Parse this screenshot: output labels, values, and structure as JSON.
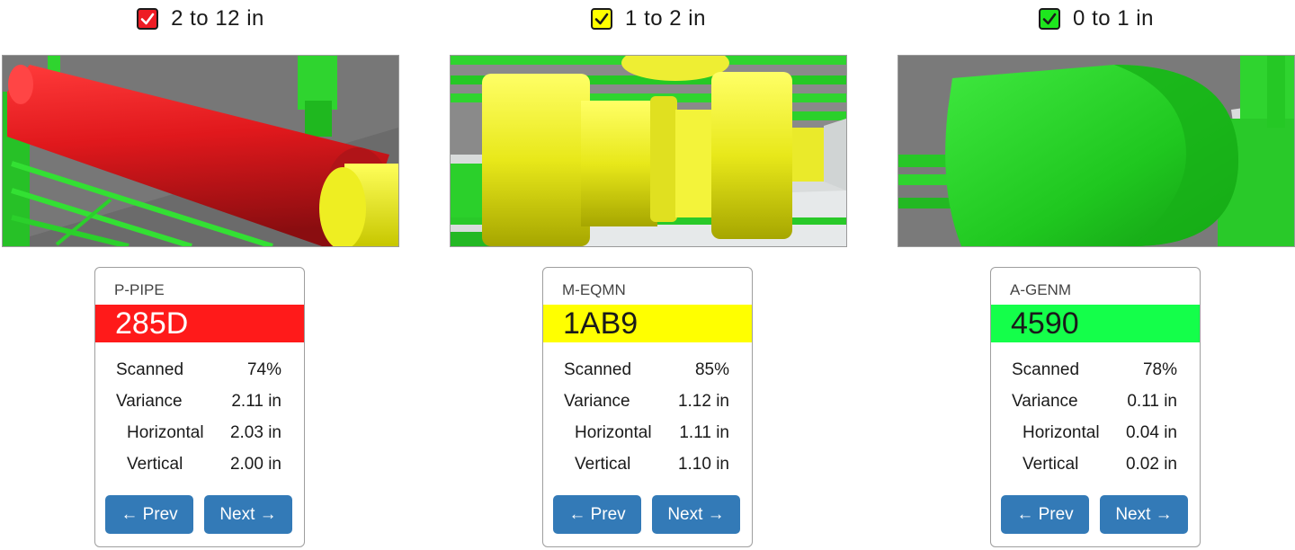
{
  "panels": [
    {
      "legend": {
        "label": "2 to 12 in",
        "color": "#ee1c24",
        "checked": true
      },
      "layer": "P-PIPE",
      "id": "285D",
      "id_color": "#ff1a1a",
      "id_text_color": "#ffffff",
      "stats": {
        "scanned_label": "Scanned",
        "scanned": "74%",
        "variance_label": "Variance",
        "variance": "2.11 in",
        "horizontal_label": "Horizontal",
        "horizontal": "2.03 in",
        "vertical_label": "Vertical",
        "vertical": "2.00 in"
      },
      "prev_label": "← Prev",
      "next_label": "Next →"
    },
    {
      "legend": {
        "label": "1 to 2 in",
        "color": "#ffff00",
        "checked": true
      },
      "layer": "M-EQMN",
      "id": "1AB9",
      "id_color": "#ffff00",
      "id_text_color": "#1a1a1a",
      "stats": {
        "scanned_label": "Scanned",
        "scanned": "85%",
        "variance_label": "Variance",
        "variance": "1.12 in",
        "horizontal_label": "Horizontal",
        "horizontal": "1.11 in",
        "vertical_label": "Vertical",
        "vertical": "1.10 in"
      },
      "prev_label": "← Prev",
      "next_label": "Next →"
    },
    {
      "legend": {
        "label": "0 to 1 in",
        "color": "#1ee61e",
        "checked": true
      },
      "layer": "A-GENM",
      "id": "4590",
      "id_color": "#14ff4a",
      "id_text_color": "#1a1a1a",
      "stats": {
        "scanned_label": "Scanned",
        "scanned": "78%",
        "variance_label": "Variance",
        "variance": "0.11 in",
        "horizontal_label": "Horizontal",
        "horizontal": "0.04 in",
        "vertical_label": "Vertical",
        "vertical": "0.02 in"
      },
      "prev_label": "← Prev",
      "next_label": "Next →"
    }
  ]
}
